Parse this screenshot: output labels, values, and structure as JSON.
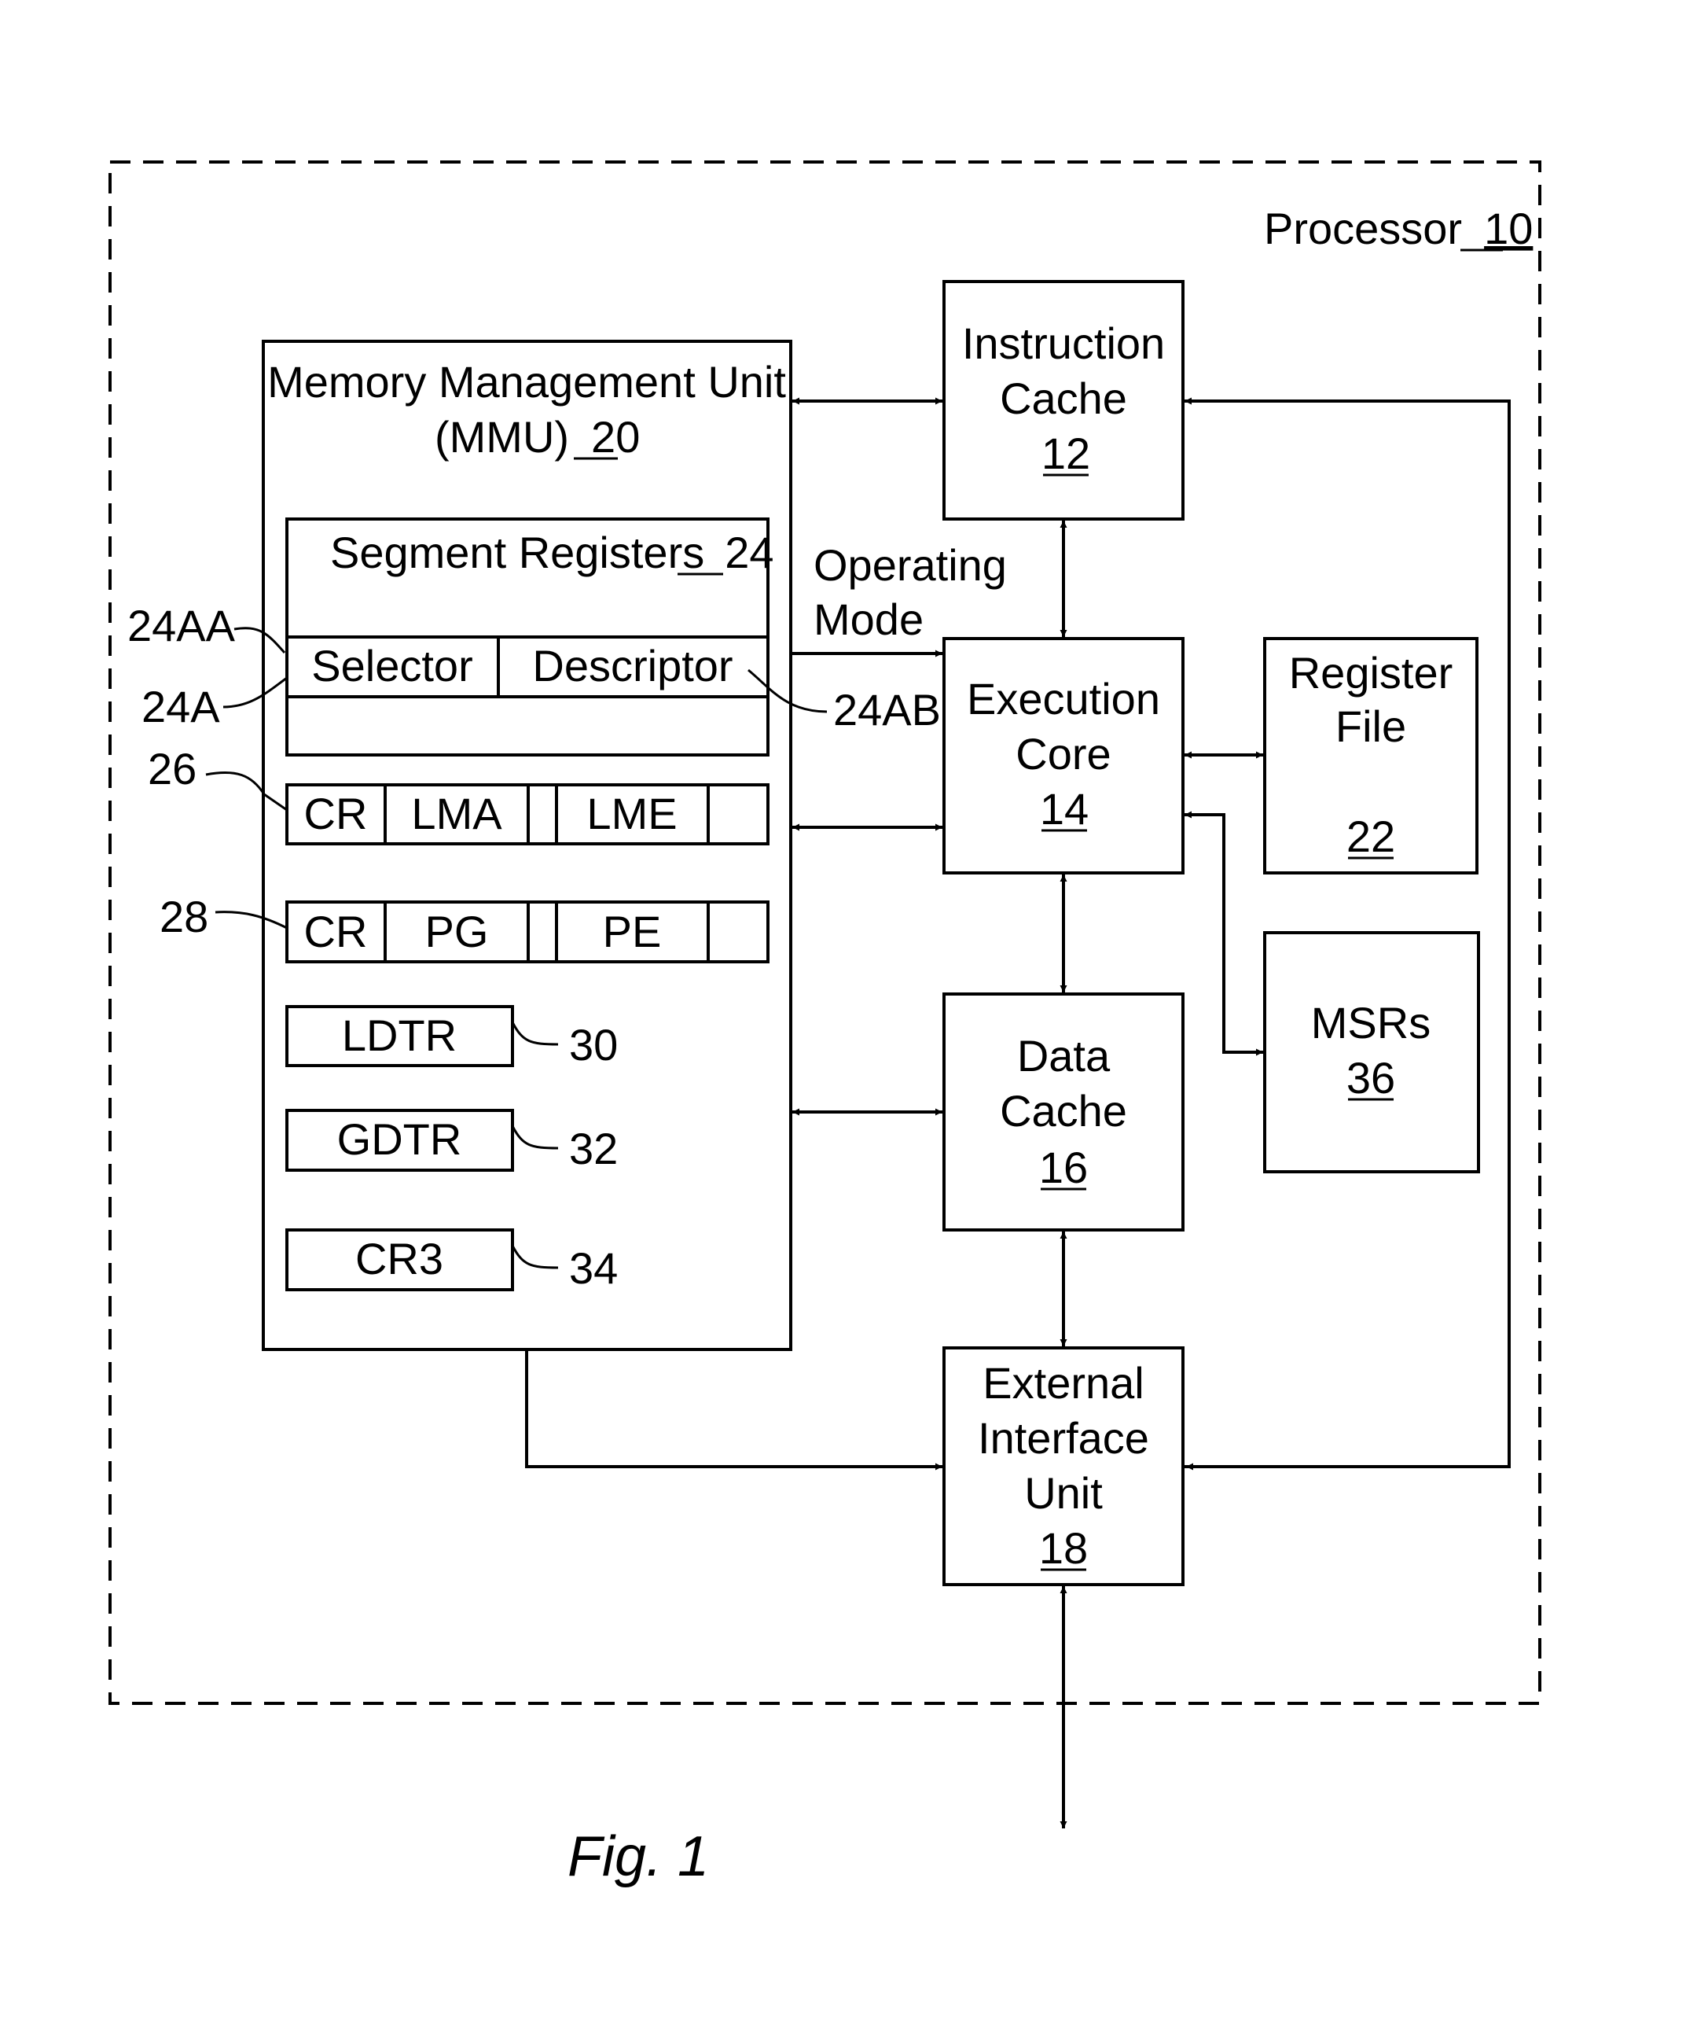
{
  "figure_caption": "Fig. 1",
  "processor": {
    "label": "Processor",
    "ref": "10"
  },
  "mmu": {
    "line1": "Memory Management Unit",
    "line2": "(MMU)",
    "ref": "20"
  },
  "segment_registers": {
    "label": "Segment Registers",
    "ref": "24",
    "selector_label": "Selector",
    "descriptor_label": "Descriptor",
    "callouts": {
      "register": "24A",
      "selector": "24AA",
      "descriptor": "24AB"
    }
  },
  "cr_lma_lme": {
    "callout": "26",
    "fields": [
      "CR",
      "LMA",
      "",
      "LME",
      ""
    ]
  },
  "cr_pg_pe": {
    "callout": "28",
    "fields": [
      "CR",
      "PG",
      "",
      "PE",
      ""
    ]
  },
  "ldtr": {
    "label": "LDTR",
    "callout": "30"
  },
  "gdtr": {
    "label": "GDTR",
    "callout": "32"
  },
  "cr3": {
    "label": "CR3",
    "callout": "34"
  },
  "instruction_cache": {
    "line1": "Instruction",
    "line2": "Cache",
    "ref": "12"
  },
  "execution_core": {
    "line1": "Execution",
    "line2": "Core",
    "ref": "14"
  },
  "data_cache": {
    "line1": "Data",
    "line2": "Cache",
    "ref": "16"
  },
  "external_interface": {
    "line1": "External",
    "line2": "Interface",
    "line3": "Unit",
    "ref": "18"
  },
  "register_file": {
    "line1": "Register",
    "line2": "File",
    "ref": "22"
  },
  "msrs": {
    "label": "MSRs",
    "ref": "36"
  },
  "operating_mode": {
    "line1": "Operating",
    "line2": "Mode"
  }
}
